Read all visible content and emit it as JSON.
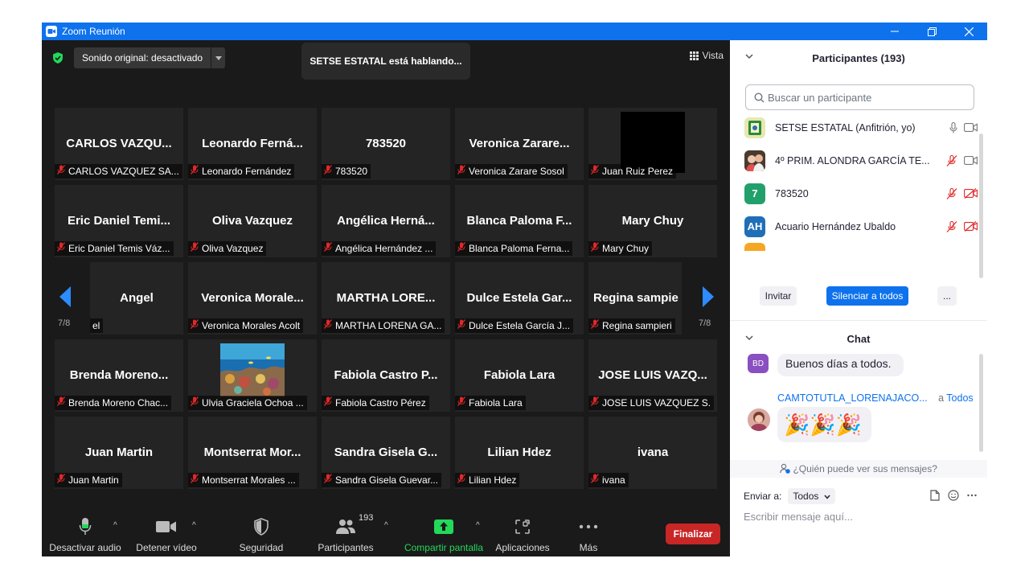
{
  "window": {
    "title": "Zoom Reunión"
  },
  "meeting": {
    "sound_label": "Sonido original: desactivado",
    "speaking_text": "SETSE ESTATAL está hablando...",
    "view_label": "Vista",
    "page_left": "7/8",
    "page_right": "7/8"
  },
  "tiles": [
    {
      "name": "CARLOS  VAZQU...",
      "label": "CARLOS VAZQUEZ SA...",
      "video": "none"
    },
    {
      "name": "Leonardo  Ferná...",
      "label": "Leonardo Fernández",
      "video": "none"
    },
    {
      "name": "783520",
      "label": "783520",
      "video": "none"
    },
    {
      "name": "Veronica  Zarare...",
      "label": "Veronica Zarare Sosol",
      "video": "none"
    },
    {
      "name": "",
      "label": "Juan Ruiz Perez",
      "video": "black"
    },
    {
      "name": "Eric  Daniel  Temi...",
      "label": "Eric Daniel Temis Váz...",
      "video": "none"
    },
    {
      "name": "Oliva Vazquez",
      "label": "Oliva Vazquez",
      "video": "none"
    },
    {
      "name": "Angélica  Herná...",
      "label": "Angélica Hernández ...",
      "video": "none"
    },
    {
      "name": "Blanca  Paloma  F...",
      "label": "Blanca Paloma Ferna...",
      "video": "none"
    },
    {
      "name": "Mary Chuy",
      "label": "Mary Chuy",
      "video": "none"
    },
    {
      "name": "Angel",
      "label": "el",
      "video": "none"
    },
    {
      "name": "Veronica  Morale...",
      "label": "Veronica Morales Acolt",
      "video": "none"
    },
    {
      "name": "MARTHA  LORE...",
      "label": "MARTHA LORENA GA...",
      "video": "none"
    },
    {
      "name": "Dulce  Estela  Gar...",
      "label": "Dulce Estela García J...",
      "video": "none"
    },
    {
      "name": "Regina  sampie",
      "label": "Regina sampieri",
      "video": "none"
    },
    {
      "name": "Brenda  Moreno...",
      "label": "Brenda Moreno Chac...",
      "video": "none"
    },
    {
      "name": "",
      "label": "Ulvia Graciela Ochoa ...",
      "video": "reef"
    },
    {
      "name": "Fabiola  Castro  P...",
      "label": "Fabiola Castro Pérez",
      "video": "none"
    },
    {
      "name": "Fabiola Lara",
      "label": "Fabiola Lara",
      "video": "none"
    },
    {
      "name": "JOSE  LUIS  VAZQ...",
      "label": "JOSE LUIS VAZQUEZ S.",
      "video": "none"
    },
    {
      "name": "Juan Martin",
      "label": "Juan Martin",
      "video": "none"
    },
    {
      "name": "Montserrat  Mor...",
      "label": "Montserrat Morales ...",
      "video": "none"
    },
    {
      "name": "Sandra  Gisela  G...",
      "label": "Sandra Gisela Guevar...",
      "video": "none"
    },
    {
      "name": "Lilian Hdez",
      "label": "Lilian Hdez",
      "video": "none"
    },
    {
      "name": "ivana",
      "label": "ivana",
      "video": "none"
    }
  ],
  "toolbar": {
    "audio": "Desactivar audio",
    "video": "Detener vídeo",
    "security": "Seguridad",
    "participants": "Participantes",
    "participants_count": "193",
    "share": "Compartir pantalla",
    "apps": "Aplicaciones",
    "more": "Más",
    "end": "Finalizar"
  },
  "participants_panel": {
    "title": "Participantes (193)",
    "search_placeholder": "Buscar un participante",
    "rows": [
      {
        "name": "SETSE ESTATAL (Anfitrión, yo)",
        "avatar": "",
        "avatar_color": "#e8e8a0",
        "muted": false,
        "video_off": false
      },
      {
        "name": "4º PRIM. ALONDRA GARCÍA TE...",
        "avatar": "",
        "avatar_color": "#6b5a50",
        "muted": true,
        "video_off": false
      },
      {
        "name": "783520",
        "avatar": "7",
        "avatar_color": "#22a06b",
        "muted": true,
        "video_off": true
      },
      {
        "name": "Acuario Hernández Ubaldo",
        "avatar": "AH",
        "avatar_color": "#1f6fb8",
        "muted": true,
        "video_off": true
      }
    ],
    "invite": "Invitar",
    "mute_all": "Silenciar a todos",
    "more": "..."
  },
  "chat": {
    "title": "Chat",
    "messages": [
      {
        "avatar": "BD",
        "avatar_color": "#8a4fc0",
        "text": "Buenos días a todos."
      },
      {
        "sender": "CAMTOTUTLA_LORENAJACO...",
        "to_prefix": "a",
        "to": "Todos",
        "text": "🎉🎉🎉"
      }
    ],
    "who_can_see": "¿Quién puede ver sus mensajes?",
    "send_to_label": "Enviar a:",
    "send_to_value": "Todos",
    "input_placeholder": "Escribir mensaje aquí..."
  },
  "colors": {
    "zoom_blue": "#0e72ed",
    "end_red": "#c92626",
    "share_green": "#23d959",
    "mute_red": "#e02828"
  }
}
